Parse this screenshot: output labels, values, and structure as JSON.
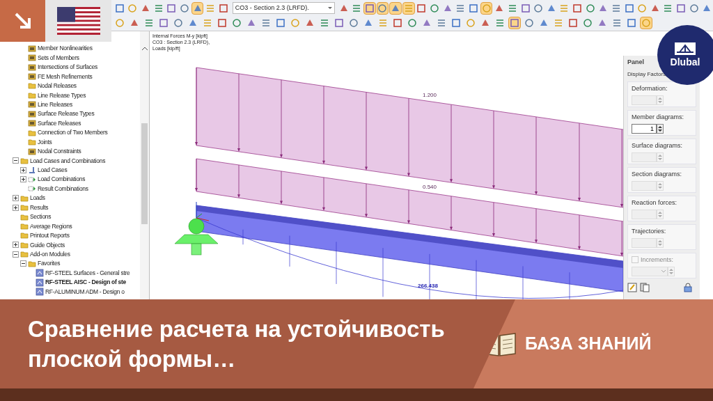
{
  "badge": {
    "kind": "arrow"
  },
  "toolbar": {
    "combo": "CO3 - Section 2.3 (LRFD).",
    "row_1_left": [
      {
        "pressed": false
      },
      {
        "pressed": false
      },
      {
        "pressed": false
      },
      {
        "pressed": false
      },
      {
        "pressed": false
      },
      {
        "pressed": false
      },
      {
        "pressed": true
      },
      {
        "pressed": false
      },
      {
        "pressed": false
      }
    ],
    "row_1_right": [
      {
        "pressed": false
      },
      {
        "pressed": false
      },
      {
        "pressed": true
      },
      {
        "pressed": true
      },
      {
        "pressed": true
      },
      {
        "pressed": true
      },
      {
        "pressed": false
      },
      {
        "pressed": false
      },
      {
        "pressed": false
      },
      {
        "pressed": false
      },
      {
        "pressed": false
      },
      {
        "pressed": true
      },
      {
        "pressed": false
      },
      {
        "pressed": false
      },
      {
        "pressed": false
      },
      {
        "pressed": false
      },
      {
        "pressed": false
      },
      {
        "pressed": false
      },
      {
        "pressed": false
      },
      {
        "pressed": false
      },
      {
        "pressed": false
      },
      {
        "pressed": false
      },
      {
        "pressed": false
      },
      {
        "pressed": false
      },
      {
        "pressed": false
      },
      {
        "pressed": false
      },
      {
        "pressed": false
      },
      {
        "pressed": false
      },
      {
        "pressed": false
      }
    ],
    "row_2": [
      {
        "pressed": false
      },
      {
        "pressed": false
      },
      {
        "pressed": false
      },
      {
        "pressed": false
      },
      {
        "pressed": false
      },
      {
        "pressed": false
      },
      {
        "pressed": false
      },
      {
        "pressed": false
      },
      {
        "pressed": false
      },
      {
        "pressed": false
      },
      {
        "pressed": false
      },
      {
        "pressed": false
      },
      {
        "pressed": false
      },
      {
        "pressed": false
      },
      {
        "pressed": false
      },
      {
        "pressed": false
      },
      {
        "pressed": false
      },
      {
        "pressed": false
      },
      {
        "pressed": false
      },
      {
        "pressed": false
      },
      {
        "pressed": false
      },
      {
        "pressed": false
      },
      {
        "pressed": false
      },
      {
        "pressed": false
      },
      {
        "pressed": false
      },
      {
        "pressed": false
      },
      {
        "pressed": false
      },
      {
        "pressed": true
      },
      {
        "pressed": false
      },
      {
        "pressed": false
      },
      {
        "pressed": false
      },
      {
        "pressed": false
      },
      {
        "pressed": false
      },
      {
        "pressed": false
      },
      {
        "pressed": false
      },
      {
        "pressed": false
      },
      {
        "pressed": true
      }
    ]
  },
  "tree": {
    "continued_items": [
      {
        "label": "Member Nonlinearities",
        "kind": "item"
      },
      {
        "label": "Sets of Members",
        "kind": "item"
      },
      {
        "label": "Intersections of Surfaces",
        "kind": "item"
      },
      {
        "label": "FE Mesh Refinements",
        "kind": "item"
      },
      {
        "label": "Nodal Releases",
        "kind": "folder"
      },
      {
        "label": "Line Release Types",
        "kind": "folder"
      },
      {
        "label": "Line Releases",
        "kind": "item"
      },
      {
        "label": "Surface Release Types",
        "kind": "item"
      },
      {
        "label": "Surface Releases",
        "kind": "item"
      },
      {
        "label": "Connection of Two Members",
        "kind": "folder"
      },
      {
        "label": "Joints",
        "kind": "folder"
      },
      {
        "label": "Nodal Constraints",
        "kind": "item"
      }
    ],
    "items": [
      {
        "label": "Load Cases and Combinations",
        "kind": "folder",
        "expanded": true,
        "children": [
          {
            "label": "Load Cases",
            "kind": "load-case",
            "expanded": false
          },
          {
            "label": "Load Combinations",
            "kind": "combination",
            "expanded": false
          },
          {
            "label": "Result Combinations",
            "kind": "combination"
          }
        ]
      },
      {
        "label": "Loads",
        "kind": "folder",
        "expanded": false
      },
      {
        "label": "Results",
        "kind": "folder",
        "expanded": false
      },
      {
        "label": "Sections",
        "kind": "folder"
      },
      {
        "label": "Average Regions",
        "kind": "folder"
      },
      {
        "label": "Printout Reports",
        "kind": "folder"
      },
      {
        "label": "Guide Objects",
        "kind": "folder",
        "expanded": false
      },
      {
        "label": "Add-on Modules",
        "kind": "folder",
        "expanded": true,
        "children": [
          {
            "label": "Favorites",
            "kind": "folder",
            "expanded": true,
            "children": [
              {
                "label": "RF-STEEL Surfaces - General stre",
                "kind": "module",
                "selected": false
              },
              {
                "label": "RF-STEEL AISC - Design of ste",
                "kind": "module",
                "selected": true
              },
              {
                "label": "RF-ALUMINUM ADM - Design o",
                "kind": "module",
                "selected": false
              }
            ]
          }
        ]
      }
    ]
  },
  "viewport": {
    "caption": [
      "Internal Forces M-y [kipft]",
      "CO3 : Section 2.3 (LRFD),",
      "Loads [kip/ft]"
    ],
    "load_upper": "1.200",
    "load_lower": "0.540",
    "moment_max": "266.438"
  },
  "panel": {
    "title": "Panel",
    "subtitle": "Display Factors",
    "groups": [
      {
        "kind": "spinner",
        "label": "Deformation:",
        "disabled": true
      },
      {
        "kind": "spinner",
        "label": "Member diagrams:",
        "value": "1",
        "disabled": false
      },
      {
        "kind": "spinner",
        "label": "Surface diagrams:",
        "disabled": true
      },
      {
        "kind": "spinner",
        "label": "Section diagrams:",
        "disabled": true
      },
      {
        "kind": "spinner",
        "label": "Reaction forces:",
        "disabled": true
      },
      {
        "kind": "spinner",
        "label": "Trajectories:",
        "disabled": true
      },
      {
        "kind": "checkbox",
        "label": "Increments:",
        "checked": false,
        "disabled": true
      }
    ]
  },
  "logo": {
    "text": "Dlubal"
  },
  "banner": {
    "title": "Сравнение расчета на устойчивость плоской формы…",
    "category": "БАЗА ЗНАНИЙ"
  }
}
